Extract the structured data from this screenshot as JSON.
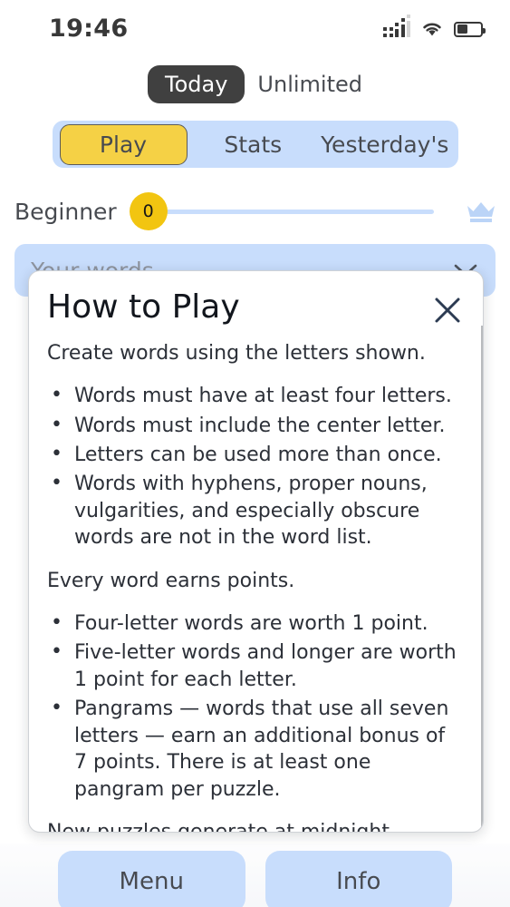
{
  "status_bar": {
    "time": "19:46",
    "signal_icon": "cellular-signal-icon",
    "wifi_icon": "wifi-icon",
    "battery_icon": "battery-icon",
    "battery_level_percent": 45
  },
  "mode_toggle": {
    "selected": "Today",
    "options": [
      "Today",
      "Unlimited"
    ]
  },
  "tabs": [
    {
      "label": "Play",
      "active": true
    },
    {
      "label": "Stats",
      "active": false
    },
    {
      "label": "Yesterday's",
      "active": false
    }
  ],
  "progress": {
    "rank_label": "Beginner",
    "score": "0",
    "crown_icon": "crown-icon"
  },
  "words_field": {
    "placeholder": "Your words...",
    "chevron_icon": "chevron-down-icon"
  },
  "modal": {
    "title": "How to Play",
    "close_icon": "close-icon",
    "intro": "Create words using the letters shown.",
    "rules": [
      "Words must have at least four letters.",
      "Words must include the center letter.",
      "Letters can be used more than once.",
      "Words with hyphens, proper nouns, vulgarities, and especially obscure words are not in the word list."
    ],
    "scoring_heading": "Every word earns points.",
    "scoring": [
      "Four-letter words are worth 1 point.",
      "Five-letter words and longer are worth 1 point for each letter.",
      "Pangrams — words that use all seven letters — earn an additional bonus of 7 points. There is at least one pangram per puzzle."
    ],
    "footer": "New puzzles generate at midnight."
  },
  "bottom_buttons": [
    {
      "label": "Menu"
    },
    {
      "label": "Info"
    }
  ],
  "colors": {
    "accent_yellow": "#f2c511",
    "accent_blue": "#b9d4fb",
    "text_dark": "#14181f",
    "pill_black": "#0b0b0b"
  }
}
